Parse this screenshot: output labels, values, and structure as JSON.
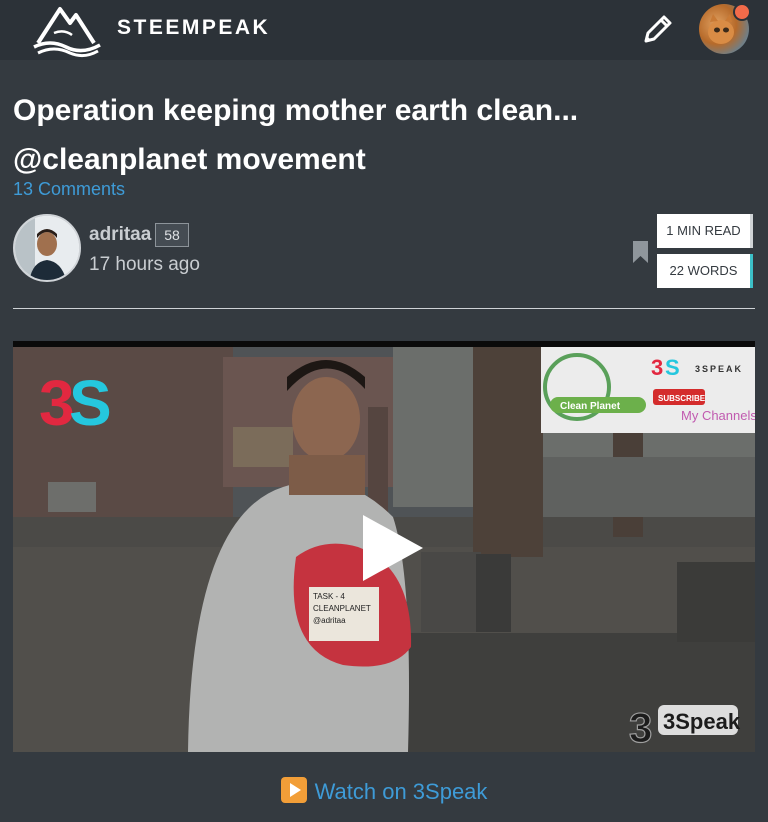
{
  "header": {
    "brand": "STEEMPEAK",
    "logo_icon": "steempeak-logo-icon",
    "edit_icon": "pencil-icon",
    "avatar_icon": "user-avatar",
    "notification_color": "#f26b4a"
  },
  "post": {
    "title": "Operation keeping mother earth clean... @cleanplanet movement",
    "comments_label": "13 Comments",
    "author": {
      "name": "adritaa",
      "reputation": "58",
      "time": "17 hours ago"
    },
    "bookmark_icon": "bookmark-icon",
    "read_time": "1 MIN READ",
    "word_count": "22 WORDS"
  },
  "video": {
    "play_icon": "play-icon",
    "watch_label": "Watch on 3Speak",
    "overlay": {
      "corner_logo": "3S",
      "clean_planet_label": "Clean Planet",
      "speak_label": "3SPEAK",
      "subscribe_label": "SUBSCRIBE",
      "channels_label": "My Channels",
      "watermark": "3Speak",
      "note_lines": [
        "TASK - 4",
        "CLEANPLANET",
        "@adritaa"
      ]
    }
  },
  "colors": {
    "background": "#343a40",
    "topbar": "#2c3238",
    "link": "#3e9bd7",
    "accent_teal": "#3cc0c8"
  }
}
